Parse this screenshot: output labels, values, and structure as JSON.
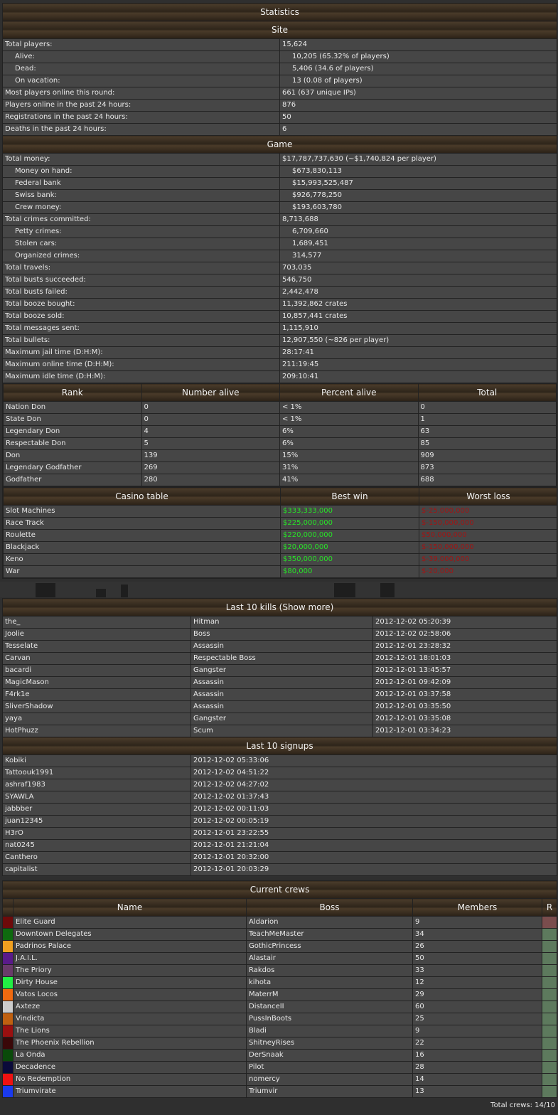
{
  "statistics": {
    "title": "Statistics",
    "site_title": "Site",
    "site": [
      {
        "label": "Total players:",
        "value": "15,624",
        "indent": false
      },
      {
        "label": "Alive:",
        "value": "10,205 (65.32% of players)",
        "indent": true
      },
      {
        "label": "Dead:",
        "value": "5,406 (34.6 of players)",
        "indent": true
      },
      {
        "label": "On vacation:",
        "value": "13 (0.08 of players)",
        "indent": true
      },
      {
        "label": "Most players online this round:",
        "value": "661 (637 unique IPs)",
        "indent": false
      },
      {
        "label": "Players online in the past 24 hours:",
        "value": "876",
        "indent": false
      },
      {
        "label": "Registrations in the past 24 hours:",
        "value": "50",
        "indent": false
      },
      {
        "label": "Deaths in the past 24 hours:",
        "value": "6",
        "indent": false
      }
    ],
    "game_title": "Game",
    "game": [
      {
        "label": "Total money:",
        "value": "$17,787,737,630 (~$1,740,824 per player)",
        "indent": false
      },
      {
        "label": "Money on hand:",
        "value": "$673,830,113",
        "indent": true
      },
      {
        "label": "Federal bank",
        "value": "$15,993,525,487",
        "indent": true
      },
      {
        "label": "Swiss bank:",
        "value": "$926,778,250",
        "indent": true
      },
      {
        "label": "Crew money:",
        "value": "$193,603,780",
        "indent": true
      },
      {
        "label": "Total crimes committed:",
        "value": "8,713,688",
        "indent": false
      },
      {
        "label": "Petty crimes:",
        "value": "6,709,660",
        "indent": true
      },
      {
        "label": "Stolen cars:",
        "value": "1,689,451",
        "indent": true
      },
      {
        "label": "Organized crimes:",
        "value": "314,577",
        "indent": true
      },
      {
        "label": "Total travels:",
        "value": "703,035",
        "indent": false
      },
      {
        "label": "Total busts succeeded:",
        "value": "546,750",
        "indent": false
      },
      {
        "label": "Total busts failed:",
        "value": "2,442,478",
        "indent": false
      },
      {
        "label": "Total booze bought:",
        "value": "11,392,862 crates",
        "indent": false
      },
      {
        "label": "Total booze sold:",
        "value": "10,857,441 crates",
        "indent": false
      },
      {
        "label": "Total messages sent:",
        "value": "1,115,910",
        "indent": false
      },
      {
        "label": "Total bullets:",
        "value": "12,907,550 (~826 per player)",
        "indent": false
      },
      {
        "label": "Maximum jail time (D:H:M):",
        "value": "28:17:41",
        "indent": false
      },
      {
        "label": "Maximum online time (D:H:M):",
        "value": "211:19:45",
        "indent": false
      },
      {
        "label": "Maximum idle time (D:H:M):",
        "value": "209:10:41",
        "indent": false
      }
    ],
    "rank_headers": [
      "Rank",
      "Number alive",
      "Percent alive",
      "Total"
    ],
    "ranks": [
      [
        "Nation Don",
        "0",
        "< 1%",
        "0"
      ],
      [
        "State Don",
        "0",
        "< 1%",
        "1"
      ],
      [
        "Legendary Don",
        "4",
        "6%",
        "63"
      ],
      [
        "Respectable Don",
        "5",
        "6%",
        "85"
      ],
      [
        "Don",
        "139",
        "15%",
        "909"
      ],
      [
        "Legendary Godfather",
        "269",
        "31%",
        "873"
      ],
      [
        "Godfather",
        "280",
        "41%",
        "688"
      ]
    ],
    "casino_headers": [
      "Casino table",
      "Best win",
      "Worst loss"
    ],
    "casino": [
      [
        "Slot Machines",
        "$333,333,000",
        "$-25,000,000"
      ],
      [
        "Race Track",
        "$225,000,000",
        "$-150,000,000"
      ],
      [
        "Roulette",
        "$220,000,000",
        "$50,000,000"
      ],
      [
        "Blackjack",
        "$20,000,000",
        "$-150,000,000"
      ],
      [
        "Keno",
        "$350,000,000",
        "$-39,000,000"
      ],
      [
        "War",
        "$80,000",
        "$-20,000"
      ]
    ]
  },
  "kills": {
    "title": "Last 10 kills (Show more)",
    "rows": [
      [
        "the_",
        "Hitman",
        "2012-12-02 05:20:39"
      ],
      [
        "Joolie",
        "Boss",
        "2012-12-02 02:58:06"
      ],
      [
        "Tesselate",
        "Assassin",
        "2012-12-01 23:28:32"
      ],
      [
        "Carvan",
        "Respectable Boss",
        "2012-12-01 18:01:03"
      ],
      [
        "bacardi",
        "Gangster",
        "2012-12-01 13:45:57"
      ],
      [
        "MagicMason",
        "Assassin",
        "2012-12-01 09:42:09"
      ],
      [
        "F4rk1e",
        "Assassin",
        "2012-12-01 03:37:58"
      ],
      [
        "SliverShadow",
        "Assassin",
        "2012-12-01 03:35:50"
      ],
      [
        "yaya",
        "Gangster",
        "2012-12-01 03:35:08"
      ],
      [
        "HotPhuzz",
        "Scum",
        "2012-12-01 03:34:23"
      ]
    ]
  },
  "signups": {
    "title": "Last 10 signups",
    "rows": [
      [
        "Kobiki",
        "2012-12-02 05:33:06"
      ],
      [
        "Tattoouk1991",
        "2012-12-02 04:51:22"
      ],
      [
        "ashraf1983",
        "2012-12-02 04:27:02"
      ],
      [
        "SYAWLA",
        "2012-12-02 01:37:43"
      ],
      [
        "jabbber",
        "2012-12-02 00:11:03"
      ],
      [
        "juan12345",
        "2012-12-02 00:05:19"
      ],
      [
        "H3rO",
        "2012-12-01 23:22:55"
      ],
      [
        "nat0245",
        "2012-12-01 21:21:04"
      ],
      [
        "Canthero",
        "2012-12-01 20:32:00"
      ],
      [
        "capitalist",
        "2012-12-01 20:03:29"
      ]
    ]
  },
  "crews": {
    "title": "Current crews",
    "headers": [
      "Name",
      "Boss",
      "Members",
      "R"
    ],
    "rows": [
      {
        "color": "#6e0a0a",
        "name": "Elite Guard",
        "boss": "Aldarion",
        "members": "9",
        "r_color": "#7a4d4d"
      },
      {
        "color": "#0f6a0f",
        "name": "Downtown Delegates",
        "boss": "TeachMeMaster",
        "members": "34",
        "r_color": "#5d7a5d"
      },
      {
        "color": "#f0a020",
        "name": "Padrinos Palace",
        "boss": "GothicPrincess",
        "members": "26",
        "r_color": "#5d7a5d"
      },
      {
        "color": "#5a1a8a",
        "name": "J.A.I.L.",
        "boss": "Alastair",
        "members": "50",
        "r_color": "#5d7a5d"
      },
      {
        "color": "#6a3a6a",
        "name": "The Priory",
        "boss": "Rakdos",
        "members": "33",
        "r_color": "#5d7a5d"
      },
      {
        "color": "#22ee44",
        "name": "Dirty House",
        "boss": "kihota",
        "members": "12",
        "r_color": "#5d7a5d"
      },
      {
        "color": "#f06a10",
        "name": "Vatos Locos",
        "boss": "MaterrM",
        "members": "29",
        "r_color": "#5d7a5d"
      },
      {
        "color": "#cccccc",
        "name": "Axteze",
        "boss": "DistanceII",
        "members": "60",
        "r_color": "#5d7a5d"
      },
      {
        "color": "#c06010",
        "name": "Vindicta",
        "boss": "PussInBoots",
        "members": "25",
        "r_color": "#5d7a5d"
      },
      {
        "color": "#9a1010",
        "name": "The Lions",
        "boss": "Bladi",
        "members": "9",
        "r_color": "#5d7a5d"
      },
      {
        "color": "#3a0808",
        "name": "The Phoenix Rebellion",
        "boss": "ShitneyRises",
        "members": "22",
        "r_color": "#5d7a5d"
      },
      {
        "color": "#0a4a0a",
        "name": "La Onda",
        "boss": "DerSnaak",
        "members": "16",
        "r_color": "#5d7a5d"
      },
      {
        "color": "#0a0a3a",
        "name": "Decadence",
        "boss": "Pilot",
        "members": "28",
        "r_color": "#5d7a5d"
      },
      {
        "color": "#ee1111",
        "name": "No Redemption",
        "boss": "nomercy",
        "members": "14",
        "r_color": "#5d7a5d"
      },
      {
        "color": "#1a3aee",
        "name": "Triumvirate",
        "boss": "Triumvir",
        "members": "13",
        "r_color": "#5d7a5d"
      }
    ],
    "total": "Total crews: 14/10"
  }
}
